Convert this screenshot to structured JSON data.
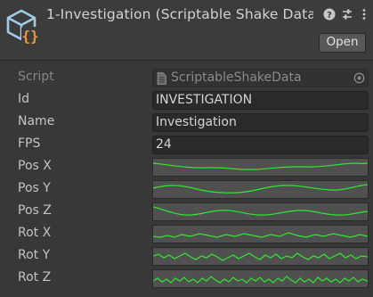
{
  "header": {
    "title": "1-Investigation (Scriptable Shake Data",
    "open_label": "Open",
    "icons": [
      "scriptable-object-icon",
      "help-icon",
      "preset-icon",
      "more-menu-icon"
    ]
  },
  "fields": {
    "script": {
      "label": "Script",
      "value": "ScriptableShakeData"
    },
    "id": {
      "label": "Id",
      "value": "INVESTIGATION"
    },
    "name": {
      "label": "Name",
      "value": "Investigation"
    },
    "fps": {
      "label": "FPS",
      "value": "24"
    }
  },
  "curves": [
    {
      "label": "Pos X"
    },
    {
      "label": "Pos Y"
    },
    {
      "label": "Pos Z"
    },
    {
      "label": "Rot X"
    },
    {
      "label": "Rot Y"
    },
    {
      "label": "Rot Z"
    }
  ],
  "colors": {
    "curve": "#2ee82e",
    "background": "#383838",
    "field": "#2a2a2a"
  }
}
